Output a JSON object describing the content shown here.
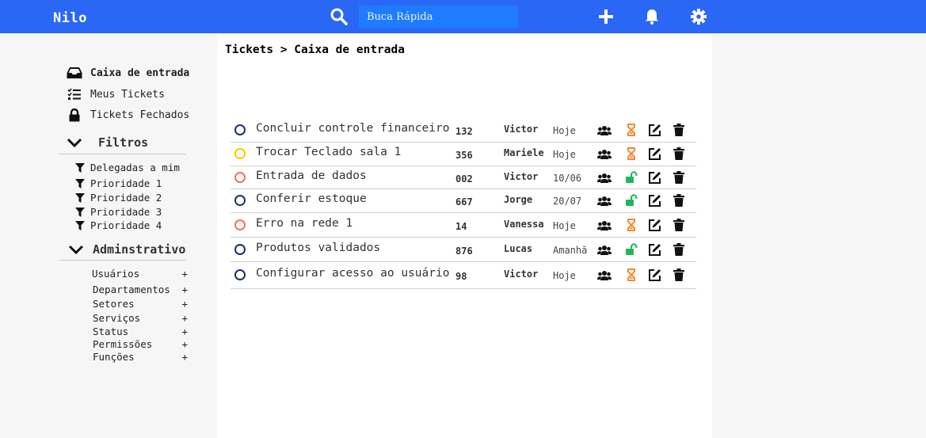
{
  "header": {
    "brand": "Nilo",
    "search_placeholder": "Buca Rápida"
  },
  "sidebar": {
    "nav": [
      {
        "label": "Caixa de entrada",
        "icon": "inbox-icon",
        "active": true
      },
      {
        "label": "Meus Tickets",
        "icon": "checklist-icon",
        "active": false
      },
      {
        "label": "Tickets Fechados",
        "icon": "lock-icon",
        "active": false
      }
    ],
    "filters_title": "Filtros",
    "filters": [
      "Delegadas a mim",
      "Prioridade 1",
      "Prioridade 2",
      "Prioridade 3",
      "Prioridade 4"
    ],
    "admin_title": "Adminstrativo",
    "admin_items": [
      {
        "label": "Usuários",
        "action": "+"
      },
      {
        "label": "Departamentos",
        "action": "+"
      },
      {
        "label": "Setores",
        "action": "+"
      },
      {
        "label": "Serviços",
        "action": "+"
      },
      {
        "label": "Status",
        "action": "+"
      },
      {
        "label": "Permissões",
        "action": "+"
      },
      {
        "label": "Funções",
        "action": "+"
      }
    ]
  },
  "main": {
    "breadcrumb": "Tickets > Caixa de entrada",
    "tickets": [
      {
        "title": "Concluir controle financeiro",
        "number": "132",
        "assignee": "Victor",
        "date": "Hoje",
        "priority_color": "#1a2f6e",
        "status": "pending"
      },
      {
        "title": "Trocar Teclado sala 1",
        "number": "356",
        "assignee": "Mariele",
        "date": "Hoje",
        "priority_color": "#f5d000",
        "status": "pending"
      },
      {
        "title": "Entrada de dados",
        "number": "002",
        "assignee": "Victor",
        "date": "10/06",
        "priority_color": "#ef6f6f",
        "status": "open"
      },
      {
        "title": "Conferir estoque",
        "number": "667",
        "assignee": "Jorge",
        "date": "20/07",
        "priority_color": "#1a2f6e",
        "status": "open"
      },
      {
        "title": "Erro na rede 1",
        "number": "14",
        "assignee": "Vanessa",
        "date": "Hoje",
        "priority_color": "#ef6f6f",
        "status": "pending"
      },
      {
        "title": "Produtos validados",
        "number": "876",
        "assignee": "Lucas",
        "date": "Amanhã",
        "priority_color": "#1a2f6e",
        "status": "open"
      },
      {
        "title": "Configurar acesso ao usuário",
        "number": "98",
        "assignee": "Victor",
        "date": "Hoje",
        "priority_color": "#1a2f6e",
        "status": "pending"
      }
    ]
  },
  "colors": {
    "topbar": "#2a67f5",
    "pending_icon": "#f28a2e",
    "open_icon": "#1fb85a"
  }
}
